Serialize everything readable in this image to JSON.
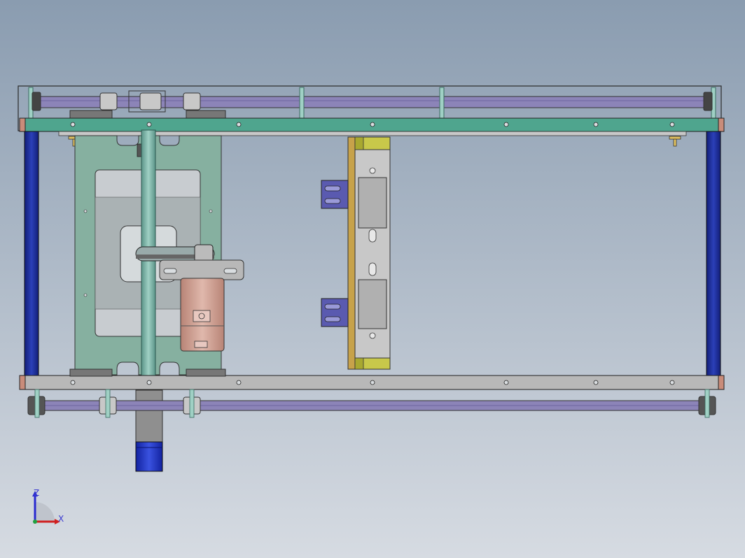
{
  "viewport": {
    "background_top": "#8a9cb0",
    "background_bottom": "#d6dbe2"
  },
  "colors": {
    "frame_outline": "#2a2a2a",
    "green_plate": "#4fa58e",
    "grey_plate": "#b8b8b8",
    "belt_purple": "#8c84b8",
    "blue_post": "#1e2f9a",
    "teal_shaft": "#78b0a4",
    "motor_copper": "#c99d90",
    "motor_cap_blue": "#1c30c0",
    "rail_tan": "#c7a24a",
    "rail_yellow": "#c8c84a",
    "bracket_blue": "#5a5ab0",
    "back_plate": "#86b0a0",
    "hole_fill": "#d9dde0"
  },
  "icons": {
    "triad": "coordinate-triad-icon",
    "pulley": "pulley-icon",
    "bolt": "bolt-icon"
  },
  "triad": {
    "z_label": "Z",
    "x_label": "X"
  }
}
